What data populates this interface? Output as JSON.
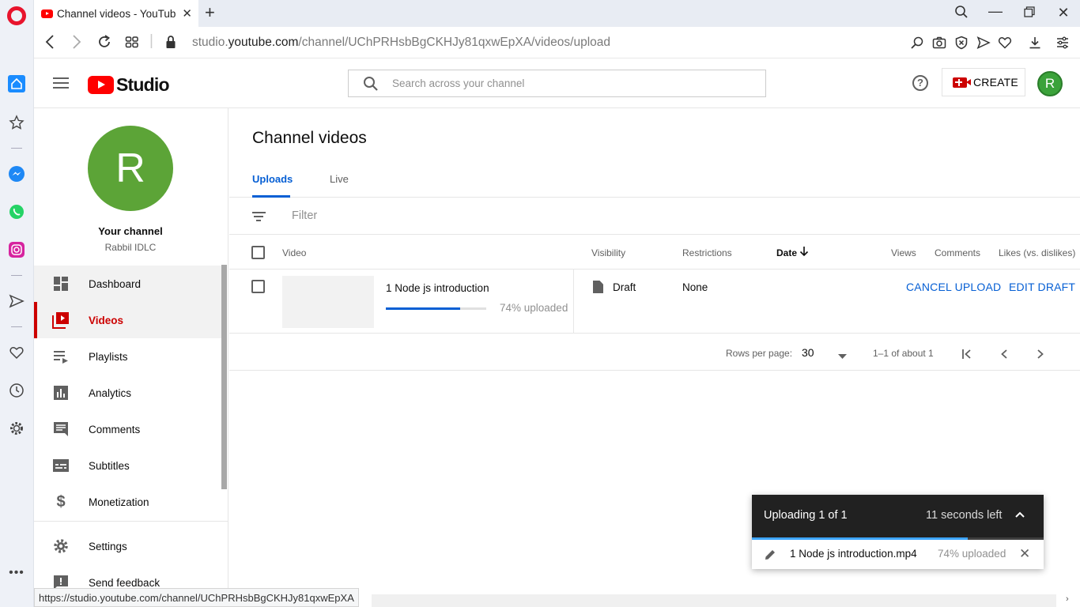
{
  "browser": {
    "tab_title": "Channel videos - YouTube",
    "url_prefix": "studio.",
    "url_domain": "youtube.com",
    "url_path": "/channel/UChPRHsbBgCKHJy81qxwEpXA/videos/upload",
    "status_url": "https://studio.youtube.com/channel/UChPRHsbBgCKHJy81qxwEpXA"
  },
  "header": {
    "logo_text": "Studio",
    "search_placeholder": "Search across your channel",
    "create_label": "CREATE",
    "avatar_letter": "R"
  },
  "sidebar": {
    "avatar_letter": "R",
    "your_channel": "Your channel",
    "channel_name": "Rabbil IDLC",
    "items": [
      {
        "label": "Dashboard",
        "icon": "dashboard-icon"
      },
      {
        "label": "Videos",
        "icon": "videos-icon"
      },
      {
        "label": "Playlists",
        "icon": "playlists-icon"
      },
      {
        "label": "Analytics",
        "icon": "analytics-icon"
      },
      {
        "label": "Comments",
        "icon": "comments-icon"
      },
      {
        "label": "Subtitles",
        "icon": "subtitles-icon"
      },
      {
        "label": "Monetization",
        "icon": "dollar-icon"
      },
      {
        "label": "Settings",
        "icon": "gear-icon"
      },
      {
        "label": "Send feedback",
        "icon": "feedback-icon"
      }
    ]
  },
  "main": {
    "title": "Channel videos",
    "tabs": [
      "Uploads",
      "Live"
    ],
    "filter_placeholder": "Filter",
    "columns": {
      "video": "Video",
      "visibility": "Visibility",
      "restrictions": "Restrictions",
      "date": "Date",
      "views": "Views",
      "comments": "Comments",
      "likes": "Likes (vs. dislikes)"
    },
    "rows": [
      {
        "title": "1 Node js introduction",
        "progress": 0.74,
        "progress_text": "74% uploaded",
        "visibility": "Draft",
        "restrictions": "None",
        "action_cancel": "CANCEL UPLOAD",
        "action_edit": "EDIT DRAFT"
      }
    ],
    "pager": {
      "rows_per_page_label": "Rows per page:",
      "rows_per_page": "30",
      "range": "1–1 of about 1"
    }
  },
  "toast": {
    "title": "Uploading 1 of 1",
    "time_left": "11 seconds left",
    "progress": 0.74,
    "file": "1 Node js introduction.mp4",
    "pct": "74% uploaded"
  },
  "colors": {
    "accent": "#065fd4",
    "brand_red": "#ff0000",
    "active_red": "#cc0000",
    "avatar_green": "#5ca437"
  }
}
